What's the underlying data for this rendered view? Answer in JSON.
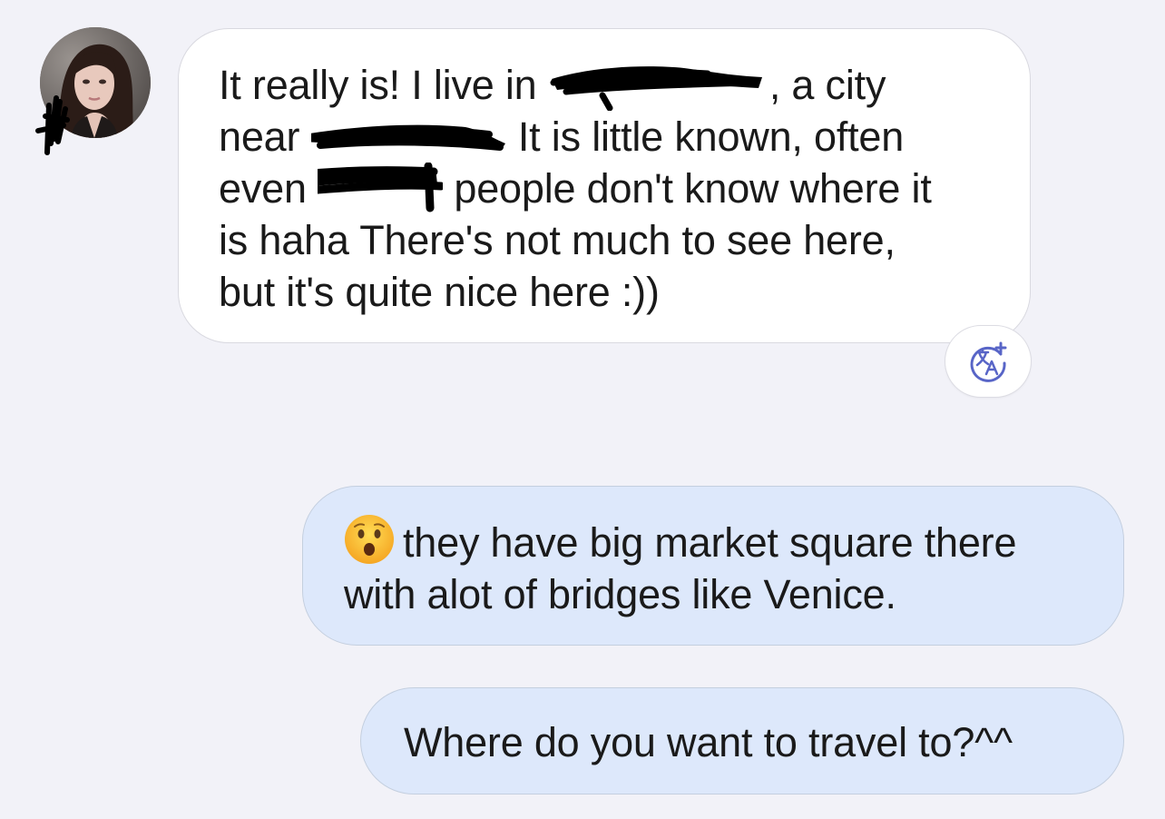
{
  "incoming_message": {
    "line1_a": "It really is! I live in ",
    "line1_b": ", a city",
    "line2_a": "near ",
    "line2_b": " It is little known, often",
    "line3_a": "even ",
    "line3_b": " people don't know where it",
    "line4": "is haha There's not much to see here,",
    "line5": "but it's quite nice here :))"
  },
  "outgoing_messages": [
    {
      "emoji": "hushed-face-emoji",
      "line1": "they have big market square there",
      "line2": "with alot of bridges like Venice."
    },
    {
      "text": "Where do you want to travel to?^^"
    }
  ],
  "translate_button": {
    "icon": "translate-icon"
  },
  "colors": {
    "background": "#f2f2f8",
    "incoming_bubble": "#ffffff",
    "outgoing_bubble": "#dde8fb",
    "translate_icon": "#5865c7"
  }
}
